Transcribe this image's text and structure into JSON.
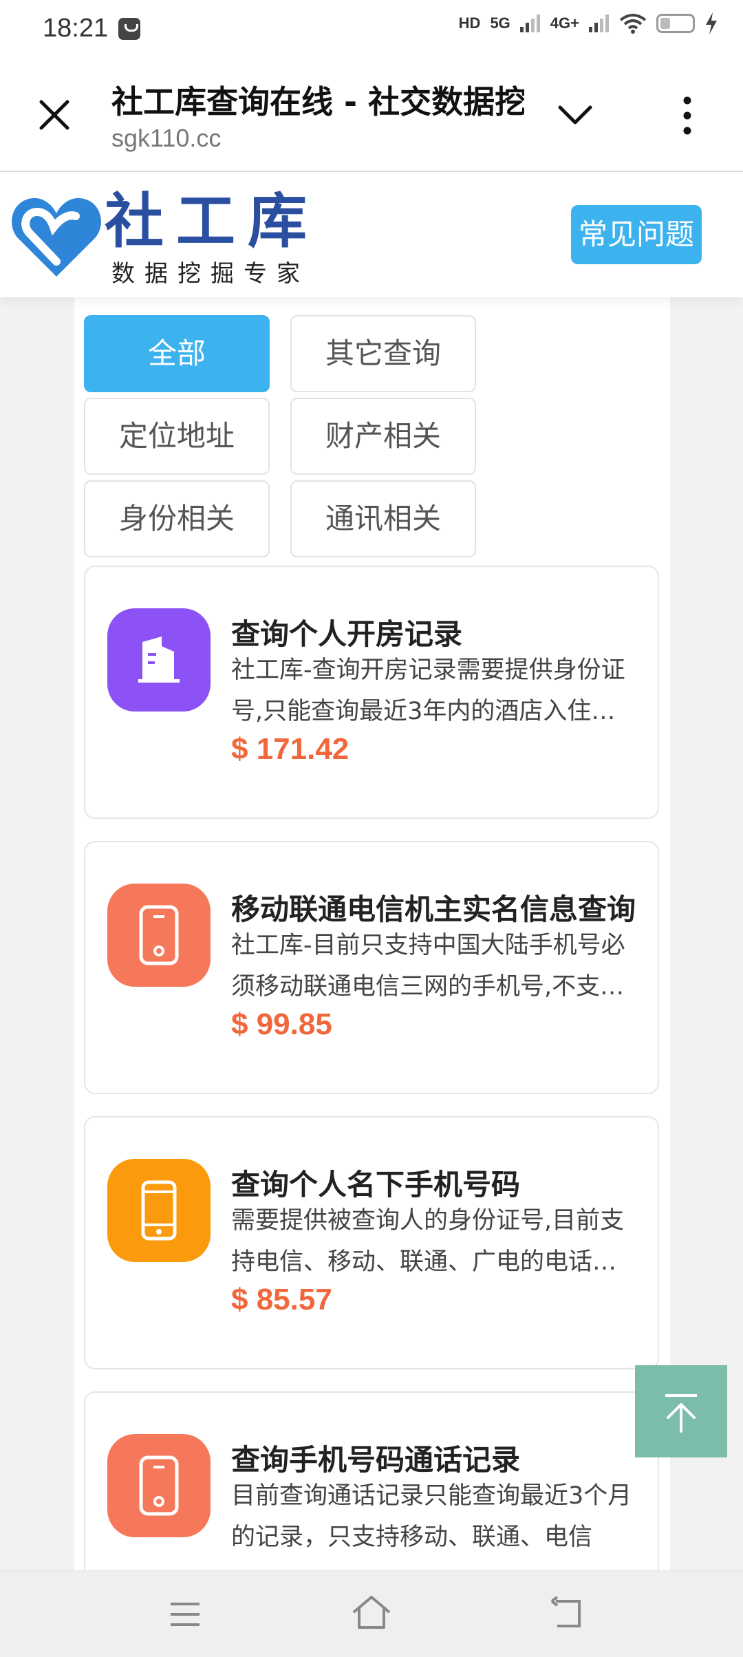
{
  "status_bar": {
    "time": "18:21",
    "hd": "HD",
    "net1": "5G",
    "net2": "4G+"
  },
  "browser": {
    "title": "社工库查询在线 - 社交数据挖",
    "url": "sgk110.cc"
  },
  "site": {
    "logo_title": "社工库",
    "logo_subtitle": "数据挖掘专家",
    "faq_label": "常见问题",
    "brand_color": "#3cb3ef"
  },
  "filters": [
    {
      "label": "全部",
      "active": true
    },
    {
      "label": "其它查询",
      "active": false
    },
    {
      "label": "定位地址",
      "active": false
    },
    {
      "label": "财产相关",
      "active": false
    },
    {
      "label": "身份相关",
      "active": false
    },
    {
      "label": "通讯相关",
      "active": false
    }
  ],
  "services": [
    {
      "icon": "building-icon",
      "icon_color": "#8c52f5",
      "title": "查询个人开房记录",
      "description": "社工库-查询开房记录需要提供身份证号,只能查询最近3年内的酒店入住记录",
      "price": "$ 171.42"
    },
    {
      "icon": "phone-icon",
      "icon_color": "#f5785a",
      "title": "移动联通电信机主实名信息查询",
      "description": "社工库-目前只支持中国大陆手机号必须移动联通电信三网的手机号,不支持虚拟号",
      "price": "$ 99.85"
    },
    {
      "icon": "mobile-icon",
      "icon_color": "#fb9a0c",
      "title": "查询个人名下手机号码",
      "description": "需要提供被查询人的身份证号,目前支持电信、移动、联通、广电的电话号码",
      "price": "$ 85.57"
    },
    {
      "icon": "phone-icon",
      "icon_color": "#f5785a",
      "title": "查询手机号码通话记录",
      "description": " 目前查询通话记录只能查询最近3个月的记录，只支持移动、联通、电信",
      "price": ""
    }
  ]
}
